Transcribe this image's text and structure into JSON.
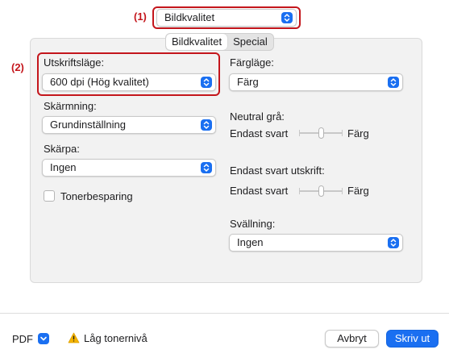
{
  "callouts": {
    "one": "(1)",
    "two": "(2)"
  },
  "top_popup": {
    "value": "Bildkvalitet"
  },
  "tabs": [
    {
      "label": "Bildkvalitet",
      "active": true
    },
    {
      "label": "Special",
      "active": false
    }
  ],
  "left": {
    "print_mode": {
      "label": "Utskriftsläge:",
      "value": "600 dpi (Hög kvalitet)"
    },
    "screening": {
      "label": "Skärmning:",
      "value": "Grundinställning"
    },
    "sharpness": {
      "label": "Skärpa:",
      "value": "Ingen"
    },
    "toner_save": {
      "label": "Tonerbesparing",
      "checked": false
    }
  },
  "right": {
    "color_mode": {
      "label": "Färgläge:",
      "value": "Färg"
    },
    "neutral_gray": {
      "label": "Neutral grå:",
      "left": "Endast svart",
      "right": "Färg",
      "level": 0.5
    },
    "black_only": {
      "label": "Endast svart utskrift:",
      "left": "Endast svart",
      "right": "Färg",
      "level": 0.5
    },
    "smoothing": {
      "label": "Svällning:",
      "value": "Ingen"
    }
  },
  "footer": {
    "pdf_label": "PDF",
    "warning_text": "Låg tonernivå",
    "cancel_label": "Avbryt",
    "print_label": "Skriv ut"
  },
  "colors": {
    "accent": "#1a6ff1",
    "callout": "#c4161c",
    "warning": "#f5b400"
  },
  "icons": {
    "popup": "chevron-updown-icon",
    "pdf": "chevron-down-icon",
    "warning": "warning-triangle-icon"
  }
}
